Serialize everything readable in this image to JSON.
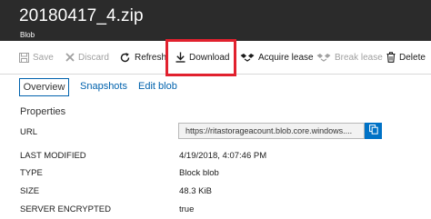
{
  "header": {
    "title": "20180417_4.zip",
    "subtitle": "Blob"
  },
  "toolbar": {
    "save_label": "Save",
    "discard_label": "Discard",
    "refresh_label": "Refresh",
    "download_label": "Download",
    "acquire_lease_label": "Acquire lease",
    "break_lease_label": "Break lease",
    "delete_label": "Delete"
  },
  "tabs": {
    "overview": "Overview",
    "snapshots": "Snapshots",
    "edit_blob": "Edit blob"
  },
  "properties": {
    "heading": "Properties",
    "url_label": "URL",
    "url_value": "https://ritastorageacount.blob.core.windows....",
    "last_modified_label": "LAST MODIFIED",
    "last_modified_value": "4/19/2018, 4:07:46 PM",
    "type_label": "TYPE",
    "type_value": "Block blob",
    "size_label": "SIZE",
    "size_value": "48.3 KiB",
    "server_encrypted_label": "SERVER ENCRYPTED",
    "server_encrypted_value": "true"
  },
  "colors": {
    "header_bg": "#2b2b2b",
    "accent": "#0062ad",
    "highlight": "#e1212e"
  },
  "icons": [
    "save-icon",
    "discard-icon",
    "refresh-icon",
    "download-icon",
    "acquire-lease-icon",
    "break-lease-icon",
    "delete-icon",
    "copy-icon"
  ]
}
